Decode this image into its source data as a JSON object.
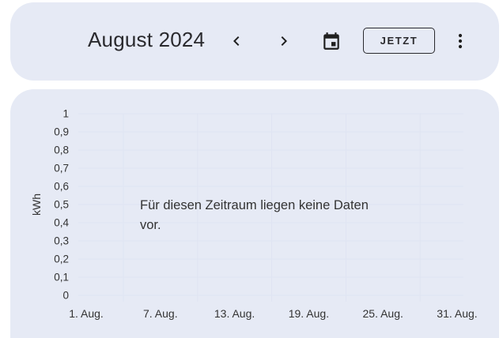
{
  "header": {
    "period_title": "August 2024",
    "prev_icon": "chevron-left-icon",
    "next_icon": "chevron-right-icon",
    "calendar_icon": "calendar-icon",
    "now_label": "JETZT",
    "more_icon": "more-vertical-icon"
  },
  "chart": {
    "no_data_message": "Für diesen Zeitraum liegen keine Daten vor."
  },
  "chart_data": {
    "type": "bar",
    "ylabel": "kWh",
    "ylim": [
      0,
      1
    ],
    "y_ticks": [
      "0",
      "0,1",
      "0,2",
      "0,3",
      "0,4",
      "0,5",
      "0,6",
      "0,7",
      "0,8",
      "0,9",
      "1"
    ],
    "x_ticks": [
      "1. Aug.",
      "7. Aug.",
      "13. Aug.",
      "19. Aug.",
      "25. Aug.",
      "31. Aug."
    ],
    "series": [],
    "grid": true,
    "colors": {
      "grid": "#dfe4f2",
      "axis_text": "#333333",
      "card_background": "#e6eaf5"
    }
  }
}
